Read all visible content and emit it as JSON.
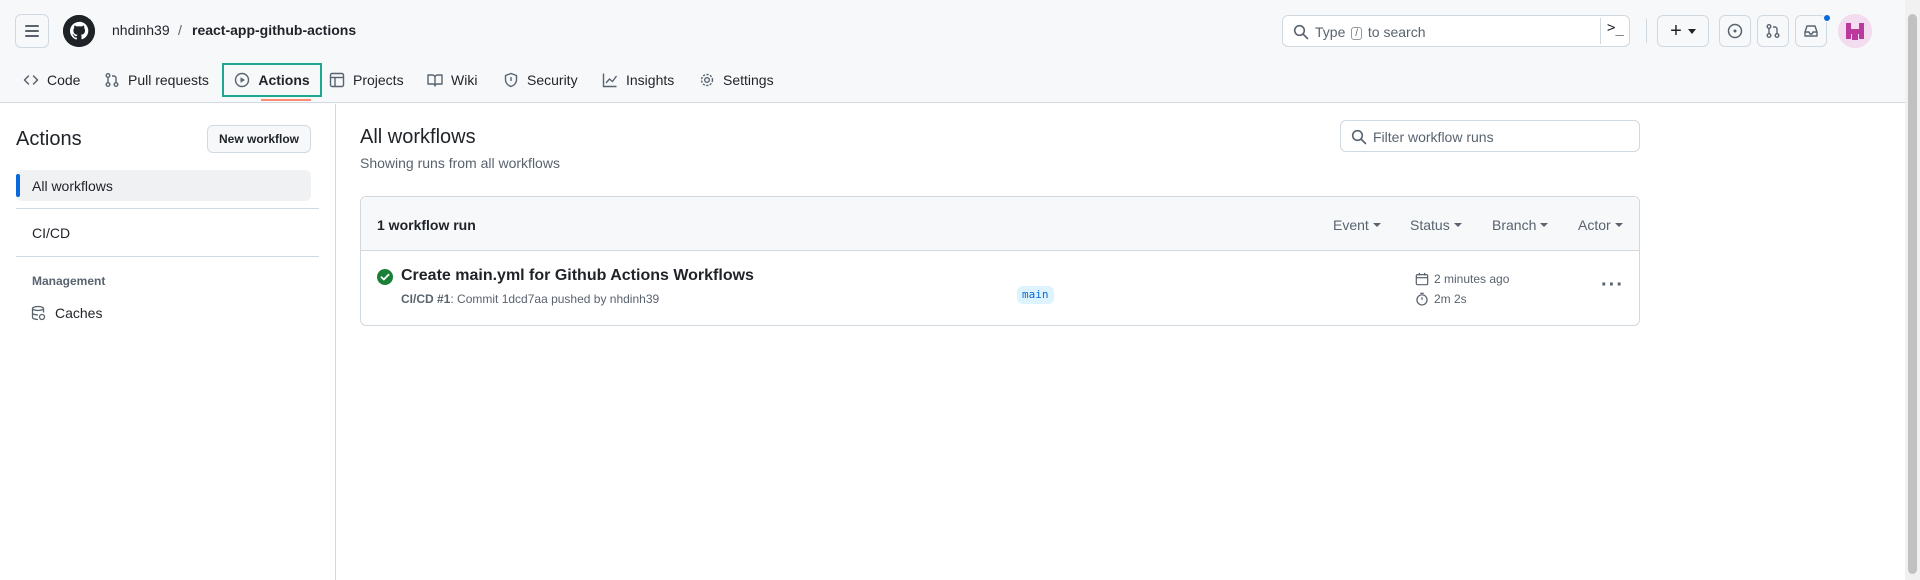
{
  "header": {
    "owner": "nhdinh39",
    "separator": "/",
    "repo": "react-app-github-actions",
    "search_hint_before": "Type",
    "search_hint_key": "/",
    "search_hint_after": "to search"
  },
  "tabs": [
    {
      "label": "Code",
      "icon": "code-icon"
    },
    {
      "label": "Pull requests",
      "icon": "git-pull-request-icon"
    },
    {
      "label": "Actions",
      "icon": "play-icon",
      "selected": true
    },
    {
      "label": "Projects",
      "icon": "table-icon"
    },
    {
      "label": "Wiki",
      "icon": "book-icon"
    },
    {
      "label": "Security",
      "icon": "shield-icon"
    },
    {
      "label": "Insights",
      "icon": "graph-icon"
    },
    {
      "label": "Settings",
      "icon": "gear-icon"
    }
  ],
  "sidebar": {
    "title": "Actions",
    "new_workflow_label": "New workflow",
    "all_workflows_label": "All workflows",
    "workflows": [
      "CI/CD"
    ],
    "management_heading": "Management",
    "caches_label": "Caches"
  },
  "main": {
    "title": "All workflows",
    "subtitle": "Showing runs from all workflows",
    "filter_placeholder": "Filter workflow runs",
    "runs_count": "1 workflow run",
    "filters": [
      "Event",
      "Status",
      "Branch",
      "Actor"
    ],
    "runs": [
      {
        "title": "Create main.yml for Github Actions Workflows",
        "workflow": "CI/CD #1",
        "meta": ": Commit 1dcd7aa pushed by nhdinh39",
        "branch": "main",
        "time_ago": "2 minutes ago",
        "duration": "2m 2s",
        "status": "success"
      }
    ]
  },
  "colors": {
    "accent": "#0969da",
    "success": "#1a7f37",
    "selection_box": "#1aa890",
    "tab_underline": "#fd8c73"
  }
}
